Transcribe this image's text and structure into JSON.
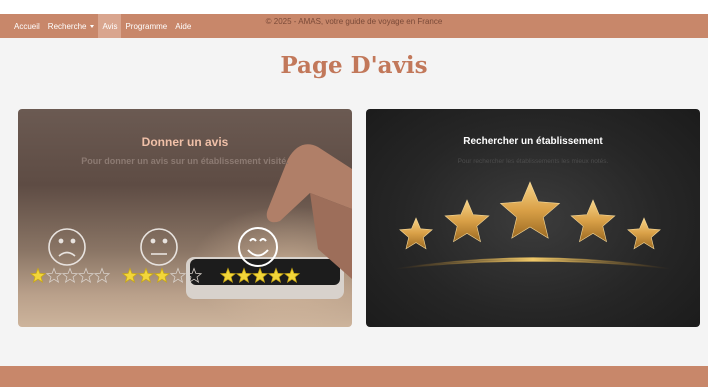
{
  "navbar": {
    "items": [
      {
        "label": "Accueil"
      },
      {
        "label": "Recherche"
      },
      {
        "label": "Avis"
      },
      {
        "label": "Programme"
      },
      {
        "label": "Aide"
      }
    ],
    "active": "Avis"
  },
  "page": {
    "title": "Page D'avis"
  },
  "cards": {
    "give": {
      "title": "Donner un avis",
      "subtitle": "Pour donner un avis sur un établissement visité.",
      "ratings_shown": [
        1,
        3,
        5
      ],
      "max_stars": 5
    },
    "search": {
      "title": "Rechercher un établissement",
      "subtitle": "Pour rechercher les établissements les mieux notés.",
      "stars_shown": 5
    }
  },
  "footer": {
    "text": "© 2025 - AMAS, votre guide de voyage en France"
  },
  "colors": {
    "brand": "#c8876a",
    "title": "#c2785a",
    "star": "#f2d63a"
  }
}
